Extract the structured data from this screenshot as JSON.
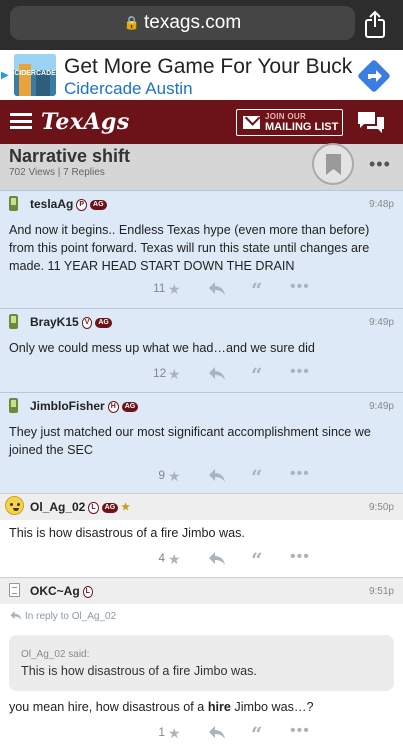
{
  "browser": {
    "url": "texags.com"
  },
  "ad": {
    "title": "Get More Game For Your Buck",
    "subtitle": "Cidercade Austin",
    "thumb_label": "CIDERCADE"
  },
  "header": {
    "logo": "TexAgs",
    "mailing_line1": "JOIN OUR",
    "mailing_line2": "MAILING LIST"
  },
  "thread": {
    "title": "Narrative shift",
    "meta": "702 Views | 7 Replies"
  },
  "posts": [
    {
      "user": "teslaAg",
      "badge_letter": "P",
      "badge_ag": "AG",
      "time": "9:48p",
      "body": "And now it begins.. Endless Texas hype (even more than before) from this point forward. Texas will run this state until changes are made. 11 YEAR HEAD START DOWN THE DRAIN",
      "stars": "11"
    },
    {
      "user": "BrayK15",
      "badge_letter": "V",
      "badge_ag": "AG",
      "time": "9:49p",
      "body": "Only we could mess up what we had…and we sure did",
      "stars": "12"
    },
    {
      "user": "JimbloFisher",
      "badge_letter": "H",
      "badge_ag": "AG",
      "time": "9:49p",
      "body": "They just matched our most significant accomplishment since we joined the SEC",
      "stars": "9"
    },
    {
      "user": "Ol_Ag_02",
      "badge_letter": "L",
      "badge_ag": "AG",
      "time": "9:50p",
      "body": "This is how disastrous of a fire Jimbo was.",
      "stars": "4"
    },
    {
      "user": "OKC~Ag",
      "badge_letter": "L",
      "time": "9:51p",
      "reply_note": "In reply to Ol_Ag_02",
      "quote_said": "Ol_Ag_02 said:",
      "quote_text": "This is how disastrous of a fire Jimbo was.",
      "body_before": "you mean hire, how disastrous of a ",
      "body_bold": "hire",
      "body_after": " Jimbo was…?",
      "stars": "1"
    }
  ],
  "colors": {
    "maroon": "#6b1318",
    "post_blue": "#dde9f6",
    "link_blue": "#1a73c9"
  }
}
